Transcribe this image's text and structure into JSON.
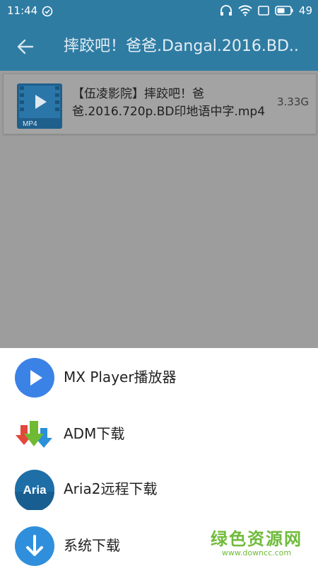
{
  "status_bar": {
    "time": "11:44",
    "battery": "49"
  },
  "app_bar": {
    "title": "摔跤吧！爸爸.Dangal.2016.BD.."
  },
  "file": {
    "name": "【伍凌影院】摔跤吧！爸爸.2016.720p.BD印地语中字.mp4",
    "size": "3.33G",
    "type_badge": "MP4",
    "icon": "video-file-icon"
  },
  "sheet": {
    "options": [
      {
        "label": "MX Player播放器",
        "icon": "play-circle-icon"
      },
      {
        "label": "ADM下载",
        "icon": "adm-arrows-icon"
      },
      {
        "label": "Aria2远程下载",
        "icon": "aria-icon",
        "badge_text": "Aria"
      },
      {
        "label": "系统下载",
        "icon": "download-circle-icon"
      }
    ]
  },
  "watermark": {
    "text": "绿色资源网",
    "url": "www.downcc.com"
  },
  "colors": {
    "primary": "#2f7ca3",
    "scrim": "#9d9d9d",
    "mx_blue": "#3b82e6",
    "aria_blue": "#1e6fa8",
    "download_blue": "#2f8fdc",
    "watermark_green": "#6fbb3a"
  }
}
